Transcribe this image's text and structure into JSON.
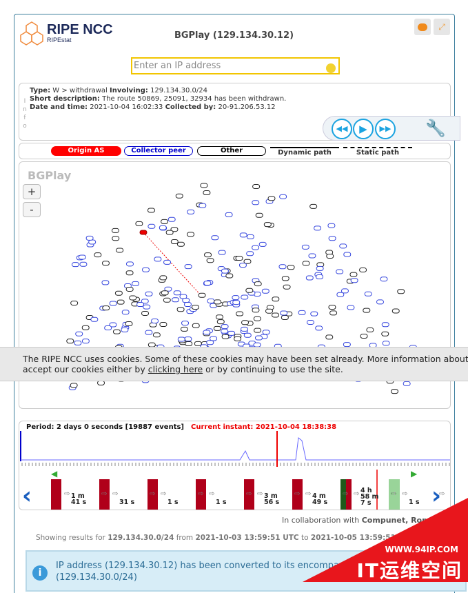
{
  "header": {
    "brand": "RIPE NCC",
    "sub_brand": "RIPEstat",
    "title": "BGPlay (129.134.30.12)",
    "feedback_icon": "speech-bubble-icon",
    "fullscreen_icon": "expand-icon"
  },
  "search": {
    "placeholder": "Enter an IP address",
    "value": ""
  },
  "info": {
    "side_label": "Info",
    "type_label": "Type:",
    "type_value": "W > withdrawal",
    "involving_label": "Involving:",
    "involving_value": "129.134.30.0/24",
    "desc_label": "Short description:",
    "desc_value": "The route 50869, 25091, 32934 has been withdrawn.",
    "date_label": "Date and time:",
    "date_value": "2021-10-04 16:02:33",
    "collected_label": "Collected by:",
    "collected_value": "20-91.206.53.12"
  },
  "controls": {
    "prev": "◀◀",
    "play": "▶",
    "next": "▶▶",
    "settings_icon": "wrench-icon"
  },
  "legend": {
    "origin": "Origin AS",
    "collector": "Collector peer",
    "other": "Other",
    "dynamic": "Dynamic path",
    "static": "Static path",
    "colors": {
      "origin": "#ff0000",
      "collector": "#0000cc",
      "other": "#000000"
    }
  },
  "graph": {
    "watermark": "BGPlay",
    "zoom_in": "+",
    "zoom_out": "-"
  },
  "cookie": {
    "text1": "The RIPE NCC uses cookies. Some of these cookies may have been set already. More information about our",
    "text2a": "accept our cookies either by ",
    "link": "clicking here",
    "text2b": " or by continuing to use the site."
  },
  "timeline": {
    "period": "Period: 2 days 0 seconds [19887 events]",
    "current": "Current instant: 2021-10-04 18:38:38",
    "gaps": [
      [
        "1 m",
        "41 s"
      ],
      [
        "",
        "31 s"
      ],
      [
        "",
        "1 s"
      ],
      [
        "",
        "1 s"
      ],
      [
        "3 m",
        "56 s"
      ],
      [
        "4 m",
        "49 s"
      ],
      [
        "4 h",
        "58 m",
        "7 s"
      ],
      [
        "",
        "1 s"
      ]
    ]
  },
  "footer": {
    "collab_prefix": "In collaboration with ",
    "collab": "Compunet, Roma T",
    "showing": "Showing results for ",
    "prefix": "129.134.30.0/24",
    "from": " from ",
    "start": "2021-10-03 13:59:51 UTC",
    "to": " to ",
    "end": "2021-10-05 13:59:51 UTC",
    "notice": "IP address (129.134.30.12) has been converted to its encompassing",
    "notice2": "(129.134.30.0/24)"
  },
  "watermark": {
    "url": "WWW.94IP.COM",
    "text": "IT运维空间"
  }
}
